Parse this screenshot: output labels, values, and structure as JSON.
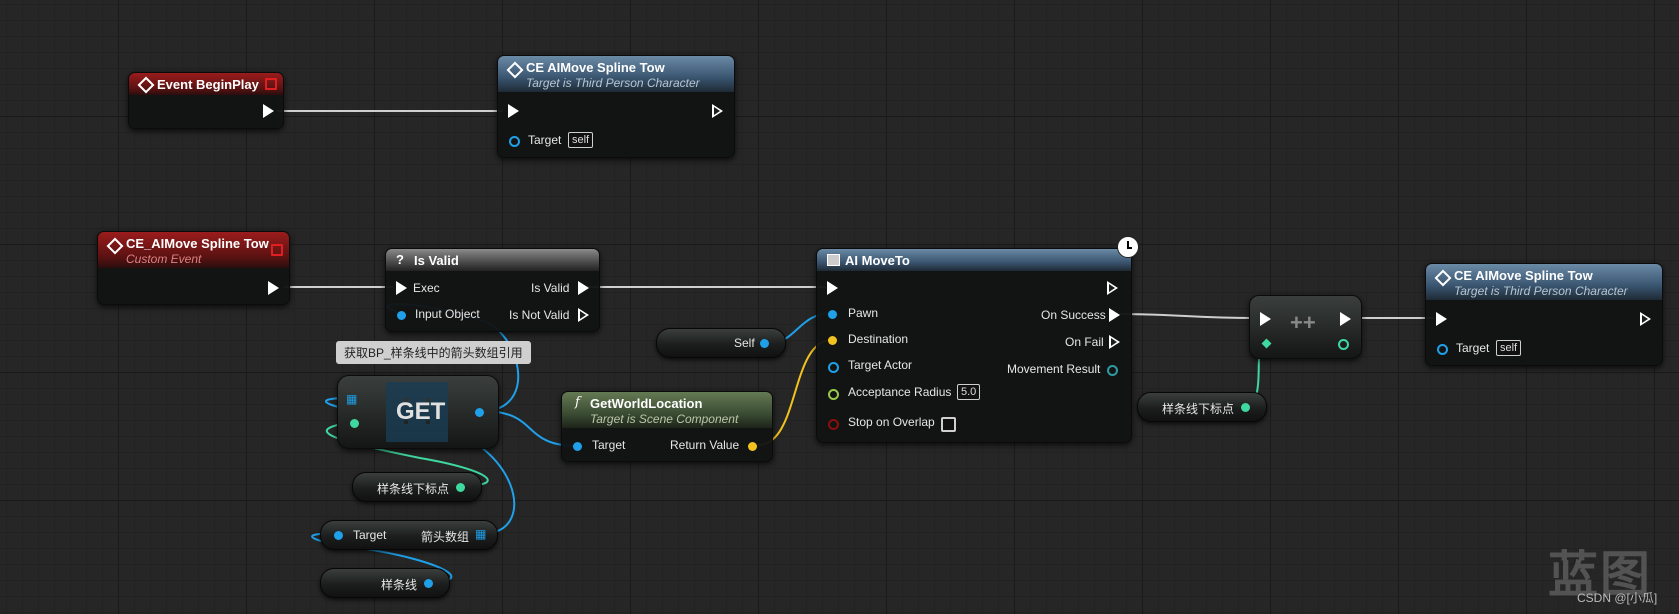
{
  "colors": {
    "exec": "#ffffff",
    "object": "#1fa0e8",
    "vector": "#f2c21e",
    "integer": "#3fd8a0",
    "event_header": "#9b1c1c",
    "function_header": "#3a5570",
    "pure_header": "#3b4c33"
  },
  "nodes": {
    "event_beginplay": {
      "title": "Event BeginPlay",
      "icon": "event-diamond-icon"
    },
    "ce_call_1": {
      "title": "CE AIMove Spline Tow",
      "subtitle": "Target is Third Person Character",
      "target_label": "Target",
      "target_value": "self"
    },
    "custom_event": {
      "title": "CE_AIMove Spline Tow",
      "subtitle": "Custom Event"
    },
    "is_valid": {
      "title": "Is Valid",
      "icon": "?",
      "exec_label": "Exec",
      "is_valid_label": "Is Valid",
      "input_object_label": "Input Object",
      "is_not_valid_label": "Is Not Valid"
    },
    "ai_moveto": {
      "title": "AI MoveTo",
      "pawn": "Pawn",
      "destination": "Destination",
      "target_actor": "Target Actor",
      "acceptance_radius": "Acceptance Radius",
      "acceptance_radius_value": "5.0",
      "stop_on_overlap": "Stop on Overlap",
      "on_success": "On Success",
      "on_fail": "On Fail",
      "movement_result": "Movement Result"
    },
    "self_node": {
      "label": "Self"
    },
    "get_world_location": {
      "title": "GetWorldLocation",
      "icon": "f",
      "subtitle": "Target is Scene Component",
      "target_label": "Target",
      "return_label": "Return Value"
    },
    "get_array": {
      "label": "GET"
    },
    "comment": {
      "text": "获取BP_样条线中的箭头数组引用"
    },
    "index_var_1": {
      "label": "样条线下标点"
    },
    "struct_get": {
      "target_label": "Target",
      "output_label": "箭头数组"
    },
    "spline_var": {
      "label": "样条线"
    },
    "increment": {
      "label": "++"
    },
    "index_var_2": {
      "label": "样条线下标点"
    },
    "ce_call_2": {
      "title": "CE AIMove Spline Tow",
      "subtitle": "Target is Third Person Character",
      "target_label": "Target",
      "target_value": "self"
    }
  },
  "watermark": {
    "text": "蓝图",
    "credit": "CSDN @[小瓜]"
  }
}
